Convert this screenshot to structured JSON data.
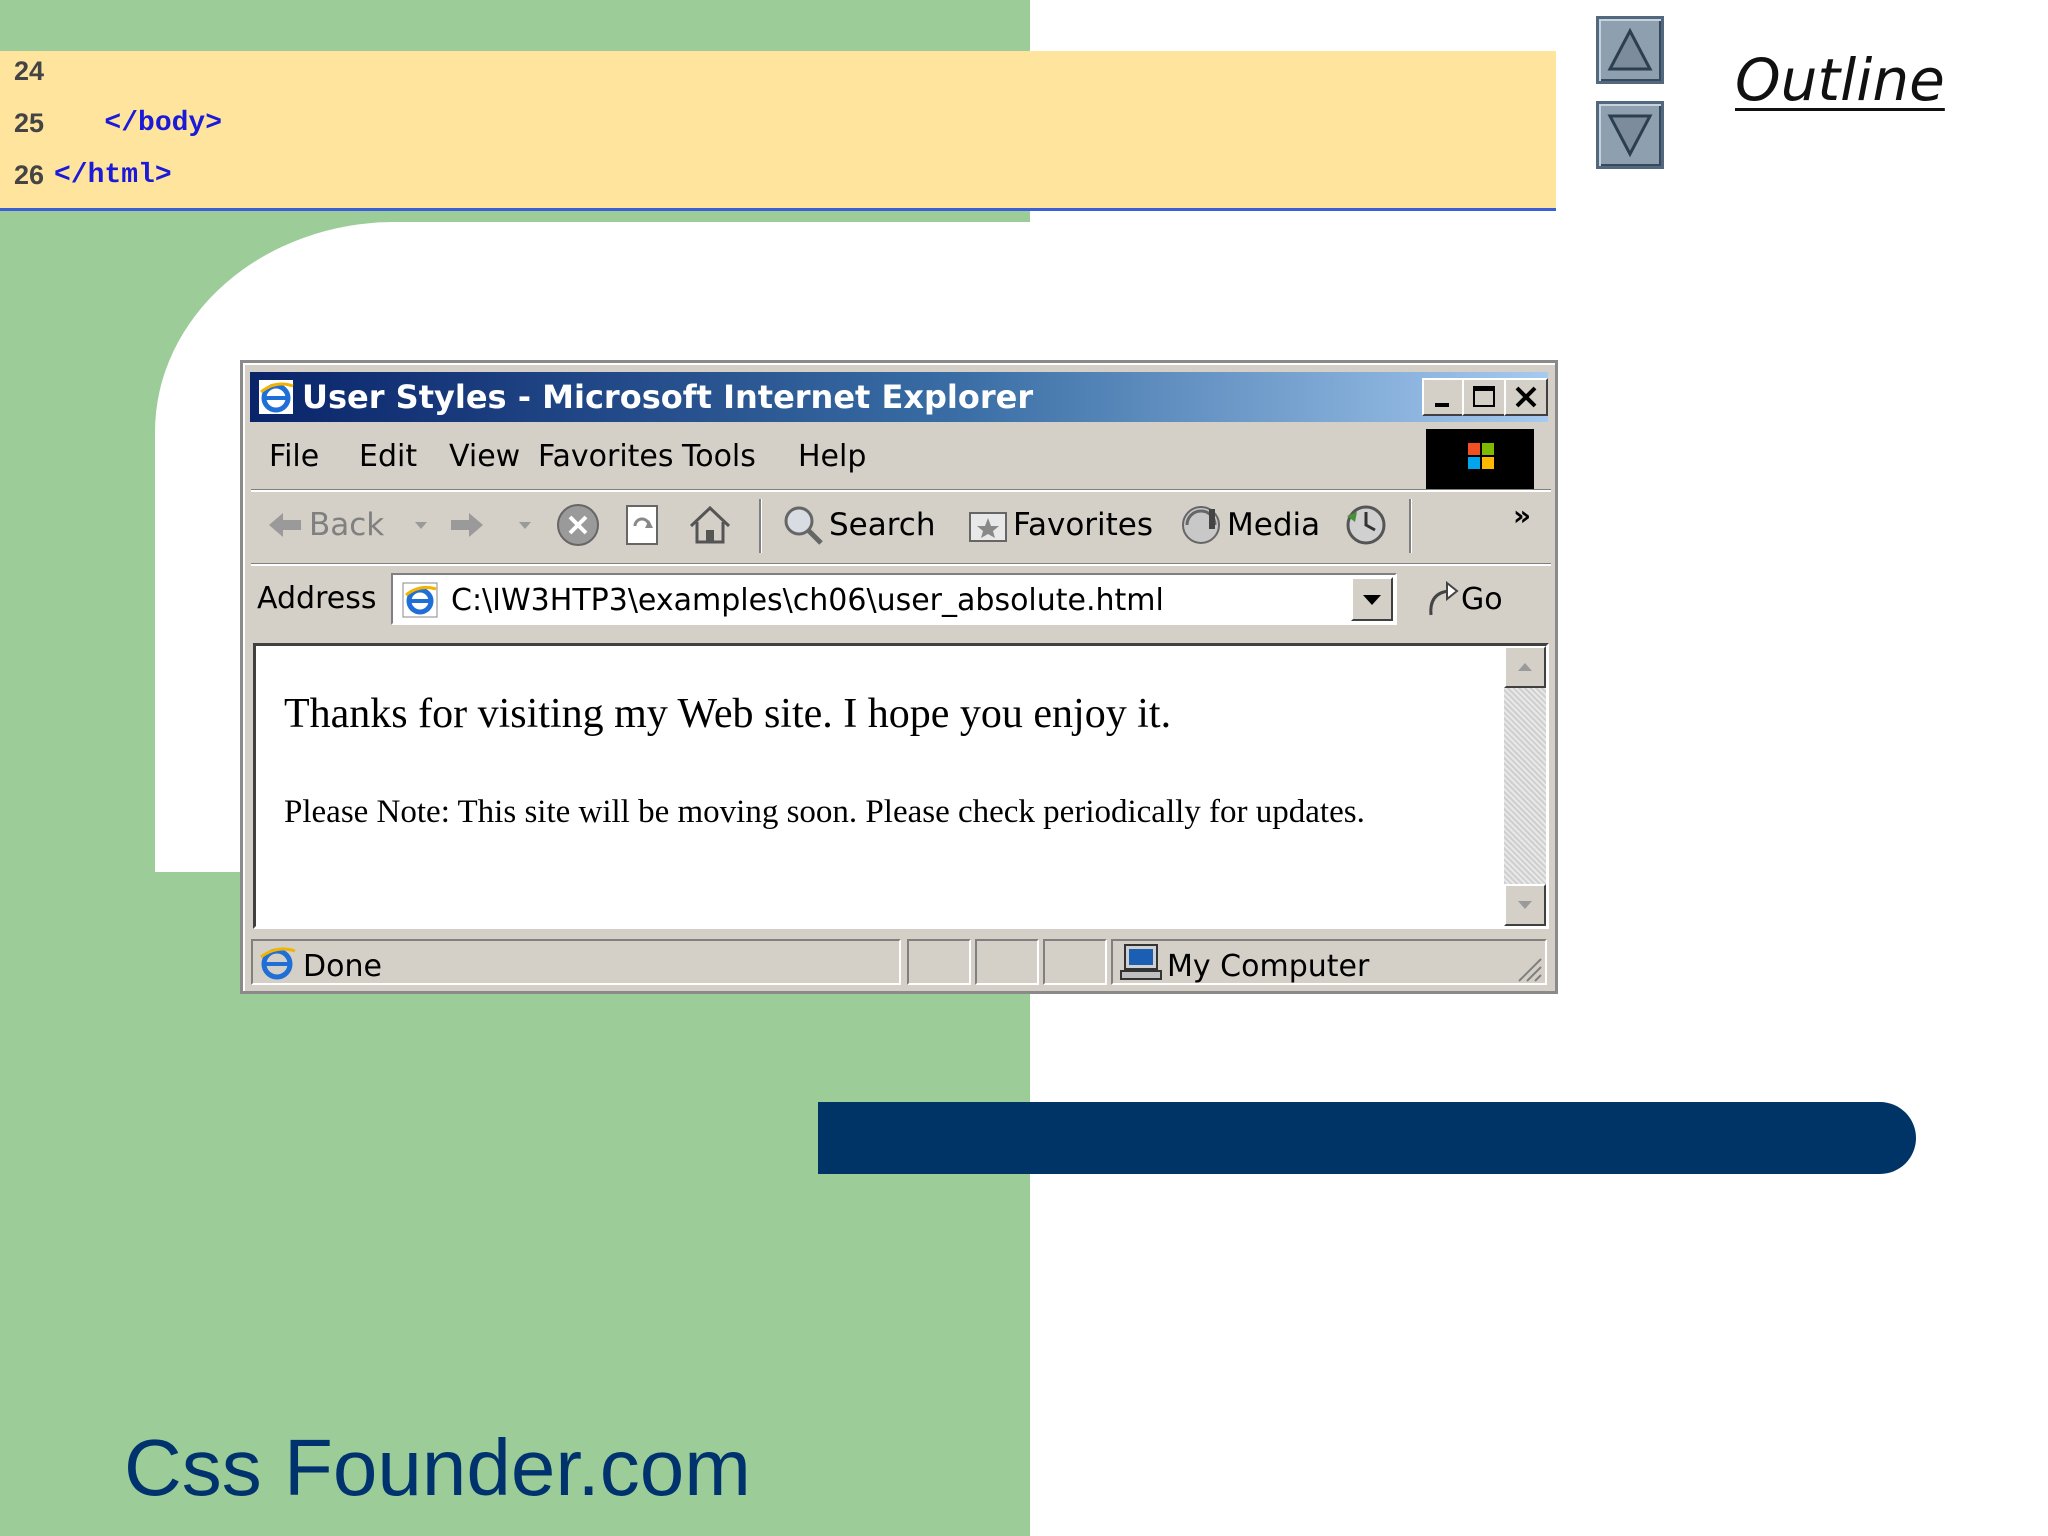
{
  "code": {
    "lines": [
      {
        "num": "24",
        "text": ""
      },
      {
        "num": "25",
        "text": "   </body>"
      },
      {
        "num": "26",
        "text": "</html>"
      }
    ]
  },
  "slide": {
    "outline_label": "Outline",
    "footer_brand": "Css Founder.com",
    "colors": {
      "green": "#9ccc98",
      "navy": "#003366",
      "code_bg": "#ffe49e"
    }
  },
  "window": {
    "title": "User Styles - Microsoft Internet Explorer",
    "menu": [
      "File",
      "Edit",
      "View",
      "Favorites",
      "Tools",
      "Help"
    ],
    "toolbar": {
      "back": "Back",
      "search": "Search",
      "favorites": "Favorites",
      "media": "Media",
      "overflow": "»"
    },
    "address": {
      "label": "Address",
      "value": "C:\\IW3HTP3\\examples\\ch06\\user_absolute.html",
      "go": "Go"
    },
    "content": {
      "heading": "Thanks for visiting my Web site. I hope you enjoy it.",
      "note": "Please Note: This site will be moving soon. Please check periodically for updates."
    },
    "status": {
      "left": "Done",
      "zone": "My Computer"
    }
  }
}
